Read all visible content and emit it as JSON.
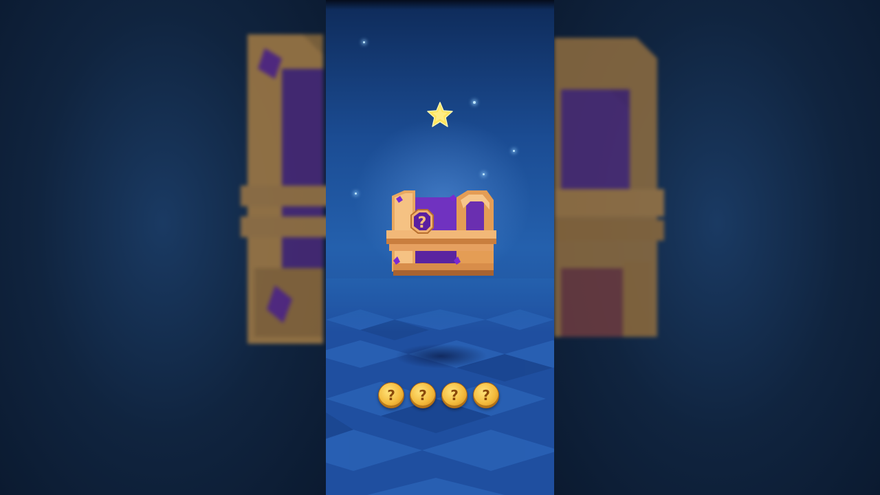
{
  "game": {
    "reward_star_icon": "star-icon",
    "chest_icon": "mystery-chest-icon",
    "chest_emblem": "?",
    "reward_slots": [
      {
        "label": "?",
        "icon": "mystery-coin-icon"
      },
      {
        "label": "?",
        "icon": "mystery-coin-icon"
      },
      {
        "label": "?",
        "icon": "mystery-coin-icon"
      },
      {
        "label": "?",
        "icon": "mystery-coin-icon"
      }
    ]
  },
  "colors": {
    "background_top": "#0e2a58",
    "background_mid": "#2460ad",
    "chest_gold": "#e6a45c",
    "chest_purple": "#6a2fb0",
    "star_yellow": "#ffe45a",
    "coin_gold": "#f3b93a"
  }
}
